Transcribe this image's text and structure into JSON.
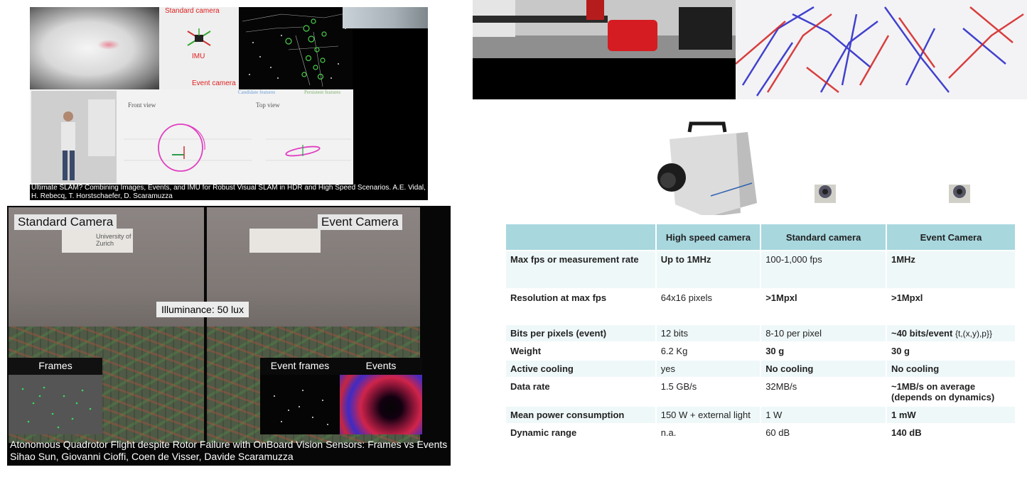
{
  "slam_video": {
    "standard_camera_label": "Standard camera",
    "imu_label": "IMU",
    "event_camera_label": "Event camera",
    "candidate_features": "Candidate features",
    "persistent_features": "Persistent features",
    "front_view": "Front view",
    "top_view": "Top view",
    "caption": "Ultimate SLAM? Combining Images, Events, and IMU for Robust Visual SLAM in HDR and High Speed Scenarios. A.E. Vidal, H. Rebecq, T. Horstschaefer, D. Scaramuzza",
    "colors": {
      "label": "#e02020",
      "trajectory": "#e040c0",
      "feature": "#4ccf4c"
    }
  },
  "quadrotor_video": {
    "standard_camera_label": "Standard Camera",
    "event_camera_label": "Event Camera",
    "sign_text": "University of Zurich",
    "illuminance": "Illuminance: 50 lux",
    "frames_label": "Frames",
    "event_frames_label": "Event frames",
    "events_label": "Events",
    "caption_line1": "Atonomous Quadrotor Flight despite Rotor Failure with OnBoard Vision Sensors: Frames vs Events",
    "caption_line2": "Sihao Sun, Giovanni Cioffi, Coen de Visser, Davide Scaramuzza"
  },
  "comparison_table": {
    "headers": [
      "",
      "High speed camera",
      "Standard camera",
      "Event Camera"
    ],
    "rows": [
      {
        "label": "Max fps or measurement rate",
        "high_speed": "Up to 1MHz",
        "standard": "100-1,000 fps",
        "event": "1MHz"
      },
      {
        "label": "Resolution at max fps",
        "high_speed": "64x16 pixels",
        "standard": ">1Mpxl",
        "event": ">1Mpxl"
      },
      {
        "label": "Bits per pixels (event)",
        "high_speed": "12 bits",
        "standard": "8-10 per pixel",
        "event": "~40 bits/event",
        "event_extra": "{t,(x,y),p}}"
      },
      {
        "label": "Weight",
        "high_speed": "6.2 Kg",
        "standard": "30 g",
        "event": "30 g"
      },
      {
        "label": "Active cooling",
        "high_speed": "yes",
        "standard": "No cooling",
        "event": "No cooling"
      },
      {
        "label": "Data rate",
        "high_speed": "1.5 GB/s",
        "standard": "32MB/s",
        "event": "~1MB/s on average (depends on dynamics)"
      },
      {
        "label": "Mean power consumption",
        "high_speed": "150 W + external light",
        "standard": "1 W",
        "event": "1 mW"
      },
      {
        "label": "Dynamic range",
        "high_speed": "n.a.",
        "standard": "60 dB",
        "event": "140 dB"
      }
    ],
    "colors": {
      "header": "#a8d7de",
      "band": "#eff8f9"
    }
  }
}
